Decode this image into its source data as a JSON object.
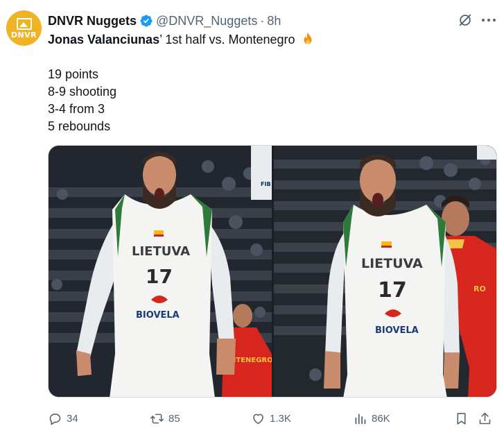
{
  "tweet": {
    "avatar_text": "DNVR",
    "display_name": "DNVR Nuggets",
    "handle": "@DNVR_Nuggets",
    "separator": "·",
    "time": "8h",
    "title_bold": "Jonas Valanciunas",
    "title_rest": "’ 1st half vs. Montenegro",
    "stats": [
      "19 points",
      "8-9 shooting",
      "3-4 from 3",
      "5 rebounds"
    ],
    "media": {
      "jersey_text": "LIETUVA",
      "jersey_number": "17",
      "sponsor_text": "BIOVELA",
      "opponent_jersey_text": "NTENEGRO",
      "opponent_jersey_text_right": "RO",
      "banner_text": "FIB"
    },
    "metrics": {
      "replies": "34",
      "reposts": "85",
      "likes": "1.3K",
      "views": "86K"
    }
  },
  "colors": {
    "accent": "#1d9bf0",
    "secondary_text": "#536471",
    "avatar_bg": "#f0b323",
    "opponent_red": "#d7261e"
  },
  "icons": [
    "verified-badge-icon",
    "grok-icon",
    "more-icon",
    "fire-emoji-icon",
    "reply-icon",
    "repost-icon",
    "like-icon",
    "views-icon",
    "bookmark-icon",
    "share-icon"
  ]
}
